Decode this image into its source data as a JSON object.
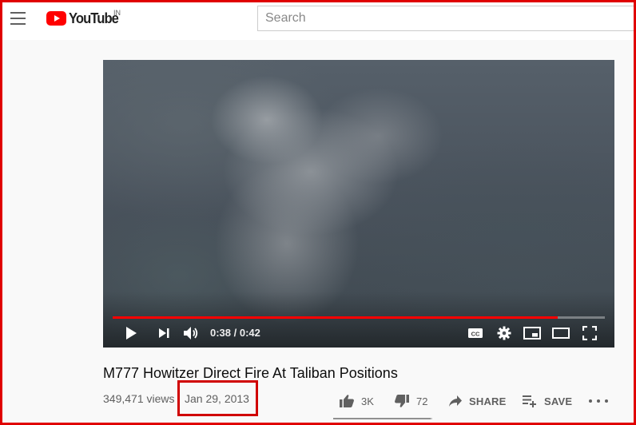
{
  "masthead": {
    "logo_text": "YouTube",
    "country_code": "IN",
    "search_placeholder": "Search"
  },
  "player": {
    "current_time": "0:38",
    "duration": "0:42",
    "time_display": "0:38 / 0:42",
    "progress_fraction": 0.905,
    "buffered_fraction": 1.0
  },
  "video": {
    "title": "M777 Howitzer Direct Fire At Taliban Positions",
    "views": "349,471 views",
    "date": "Jan 29, 2013"
  },
  "actions": {
    "like_count": "3K",
    "dislike_count": "72",
    "share_label": "SHARE",
    "save_label": "SAVE"
  },
  "colors": {
    "brand_red": "#ff0000",
    "highlight_box": "#d00000"
  }
}
